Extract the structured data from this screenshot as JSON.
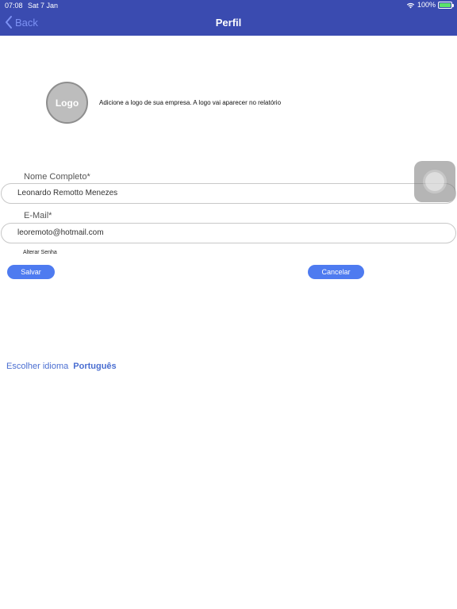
{
  "status_bar": {
    "time": "07:08",
    "date": "Sat 7 Jan",
    "battery": "100%"
  },
  "nav": {
    "back_label": "Back",
    "title": "Perfil"
  },
  "logo": {
    "placeholder_text": "Logo",
    "description": "Adicione a logo de sua empresa. A logo vai aparecer no relatório"
  },
  "form": {
    "name_label": "Nome Completo*",
    "name_value": "Leonardo Remotto Menezes",
    "email_label": "E-Mail*",
    "email_value": "leoremoto@hotmail.com",
    "change_password": "Alterar Senha"
  },
  "buttons": {
    "save": "Salvar",
    "cancel": "Cancelar"
  },
  "language": {
    "label": "Escolher idioma",
    "value": "Português"
  },
  "colors": {
    "header": "#3a4bb0",
    "accent": "#4e7bf0",
    "link": "#4a6ed1"
  }
}
